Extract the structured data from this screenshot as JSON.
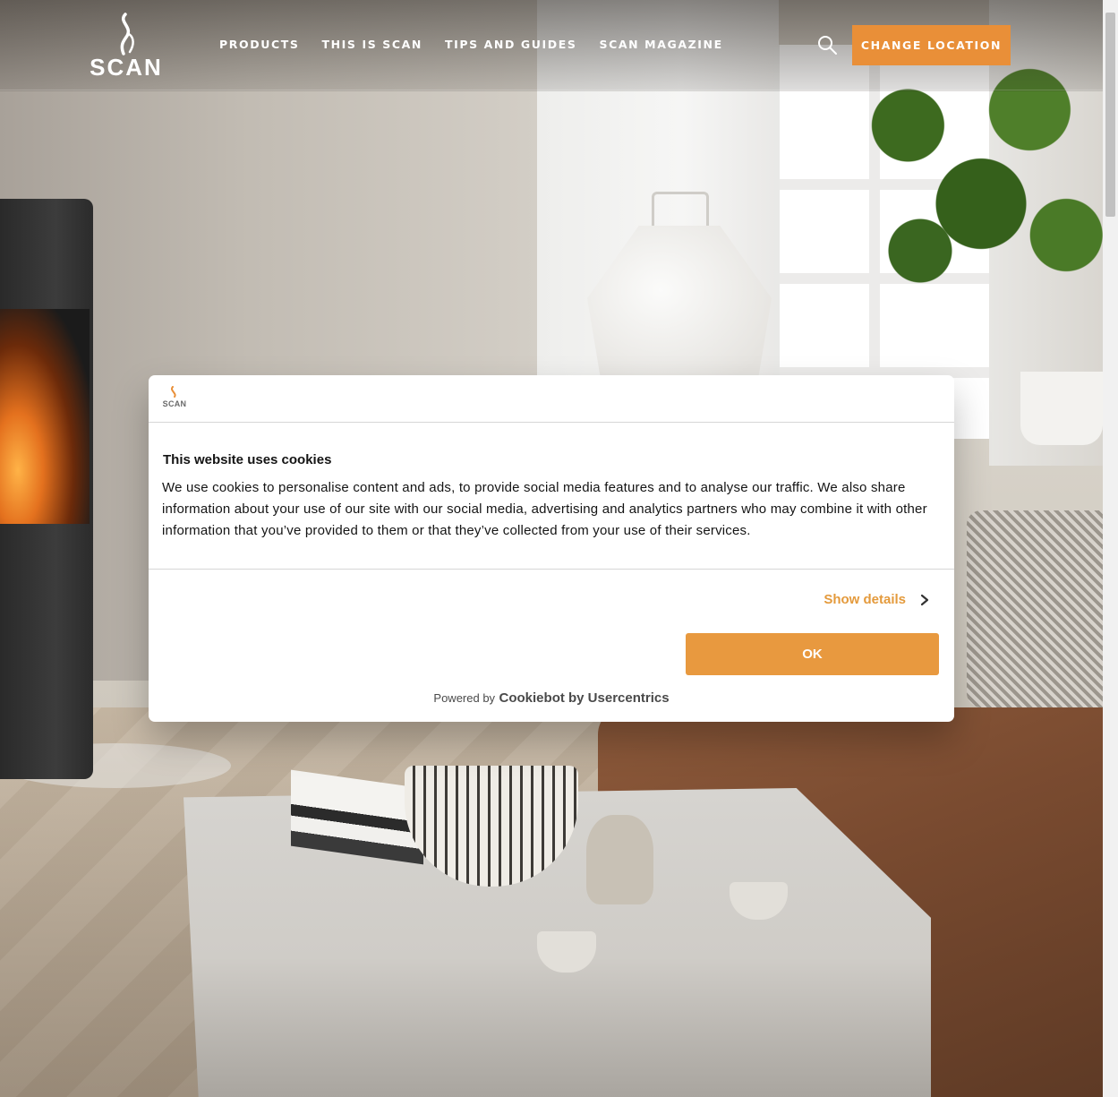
{
  "header": {
    "logo_text": "SCAN",
    "nav": [
      {
        "label": "PRODUCTS"
      },
      {
        "label": "THIS IS SCAN"
      },
      {
        "label": "TIPS AND GUIDES"
      },
      {
        "label": "SCAN MAGAZINE"
      }
    ],
    "search_icon": "search-icon",
    "cta_label": "CHANGE LOCATION"
  },
  "cookie_dialog": {
    "logo_text": "SCAN",
    "title": "This website uses cookies",
    "body": "We use cookies to personalise content and ads, to provide social media features and to analyse our traffic. We also share information about your use of our site with our social media, advertising and analytics partners who may combine it with other information that you’ve provided to them or that they’ve collected from your use of their services.",
    "show_details_label": "Show details",
    "ok_label": "OK",
    "powered_prefix": "Powered by",
    "powered_brand": "Cookiebot by Usercentrics"
  },
  "colors": {
    "accent": "#e98f38",
    "dialog_accent": "#e8993f",
    "link": "#e49a3c"
  }
}
